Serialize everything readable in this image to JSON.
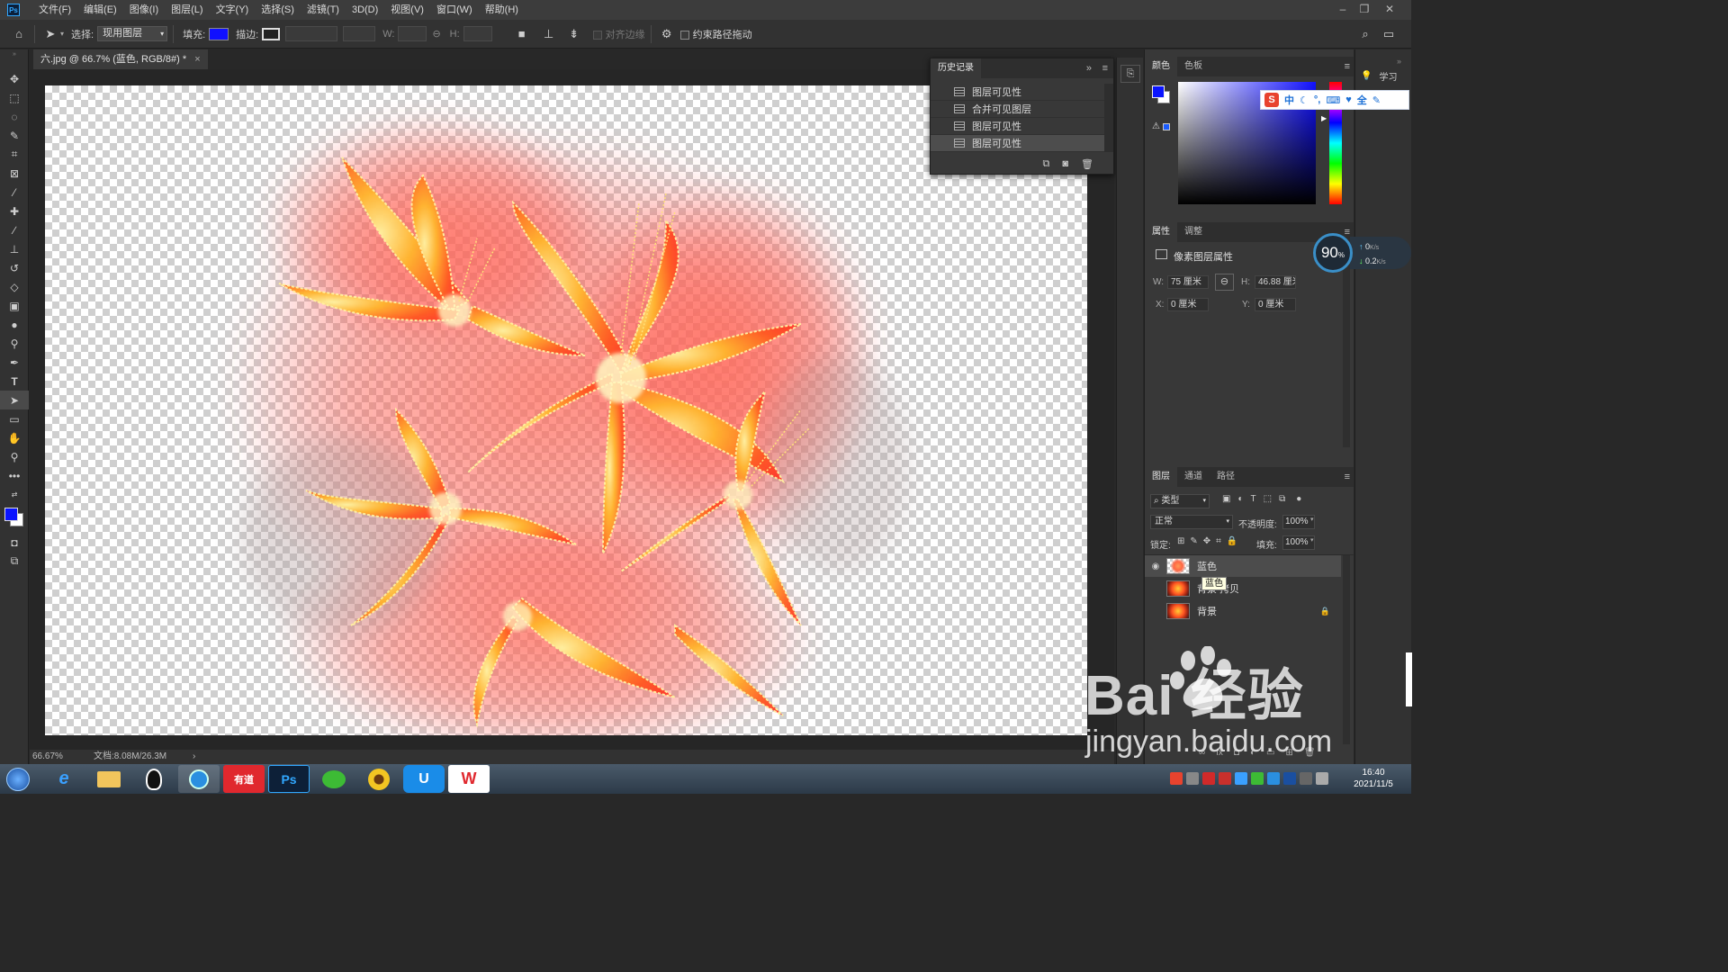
{
  "app": {
    "logo": "Ps"
  },
  "menu": [
    "文件(F)",
    "编辑(E)",
    "图像(I)",
    "图层(L)",
    "文字(Y)",
    "选择(S)",
    "滤镜(T)",
    "3D(D)",
    "视图(V)",
    "窗口(W)",
    "帮助(H)"
  ],
  "options": {
    "select_label": "选择:",
    "select_value": "现用图层",
    "fill_label": "填充:",
    "stroke_label": "描边:",
    "w_label": "W:",
    "h_label": "H:",
    "align_edges": "对齐边缘",
    "constrain_path": "约束路径拖动",
    "fill_color": "#1010ff"
  },
  "document": {
    "tab_title": "六.jpg @ 66.7% (蓝色, RGB/8#) *",
    "close": "×"
  },
  "status": {
    "zoom": "66.67%",
    "doc_size": "文档:8.08M/26.3M",
    "arrow": "›"
  },
  "history": {
    "tab": "历史记录",
    "items": [
      "图层可见性",
      "合并可见图层",
      "图层可见性",
      "图层可见性"
    ],
    "selected_index": 3
  },
  "color_panel": {
    "tabs": [
      "颜色",
      "色板"
    ],
    "foreground": "#0a14ff",
    "background": "#ffffff"
  },
  "ime": {
    "items": [
      "中",
      "全"
    ]
  },
  "properties": {
    "tabs": [
      "属性",
      "调整"
    ],
    "title": "像素图层属性",
    "w_label": "W:",
    "w_value": "75 厘米",
    "h_label": "H:",
    "h_value": "46.88 厘米",
    "x_label": "X:",
    "x_value": "0 厘米",
    "y_label": "Y:",
    "y_value": "0 厘米"
  },
  "network_widget": {
    "percent": "90",
    "unit": "%",
    "up": "0",
    "down": "0.2",
    "rate_unit": "K/s"
  },
  "learn": {
    "label": "学习"
  },
  "layers_panel": {
    "tabs": [
      "图层",
      "通道",
      "路径"
    ],
    "filter": "类型",
    "blend_mode": "正常",
    "opacity_label": "不透明度:",
    "opacity": "100%",
    "lock_label": "锁定:",
    "fill_label": "填充:",
    "fill": "100%",
    "layers": [
      {
        "name": "蓝色",
        "visible": true,
        "selected": true,
        "locked": false
      },
      {
        "name": "背景 拷贝",
        "visible": false,
        "selected": false,
        "locked": false
      },
      {
        "name": "背景",
        "visible": false,
        "selected": false,
        "locked": true
      }
    ],
    "tooltip": "蓝色"
  },
  "taskbar": {
    "apps": [
      "e",
      "",
      "",
      "",
      "有道",
      "Ps",
      "",
      "",
      "U",
      "W"
    ],
    "time": "16:40",
    "date": "2021/11/5"
  },
  "watermark": {
    "line1": "Bai  经验",
    "line2": "jingyan.baidu.com"
  }
}
